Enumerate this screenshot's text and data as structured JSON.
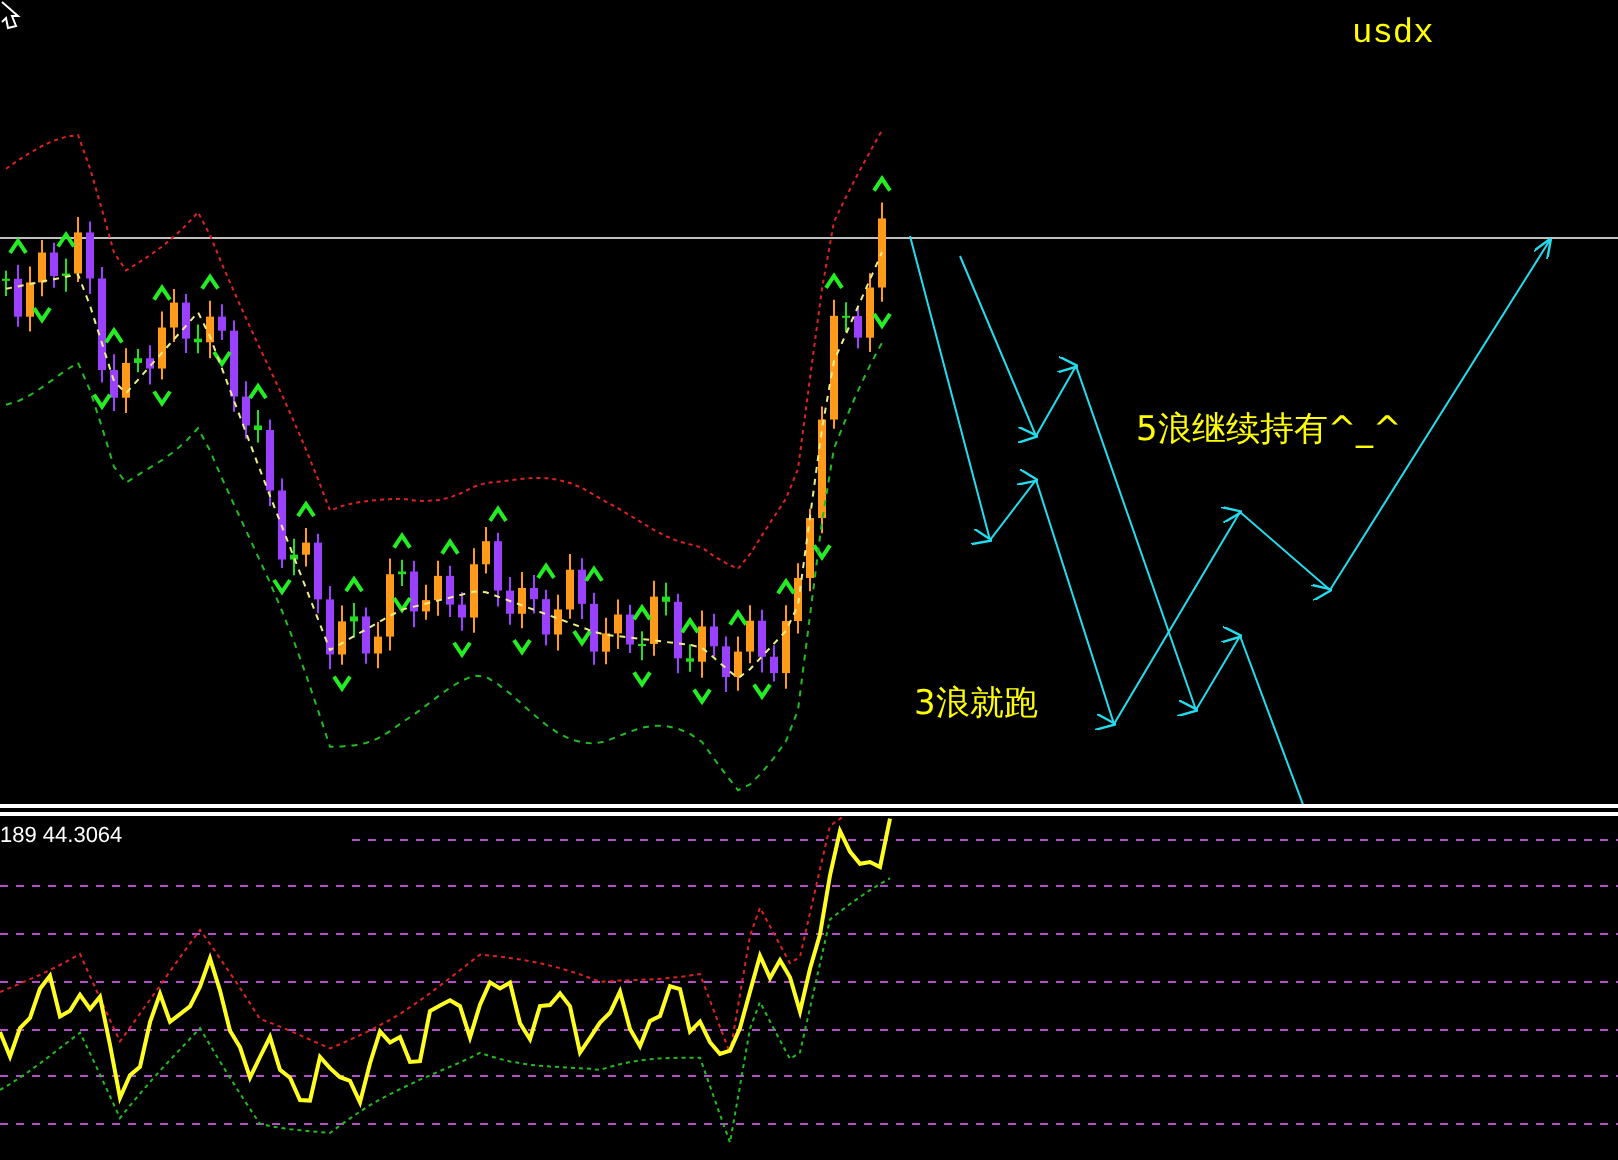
{
  "chart": {
    "symbol": "usdx",
    "annotations": [
      {
        "text": "5浪继续持有^_^"
      },
      {
        "text": "3浪就跑"
      }
    ]
  },
  "indicator": {
    "reading": "189 44.3064"
  }
}
